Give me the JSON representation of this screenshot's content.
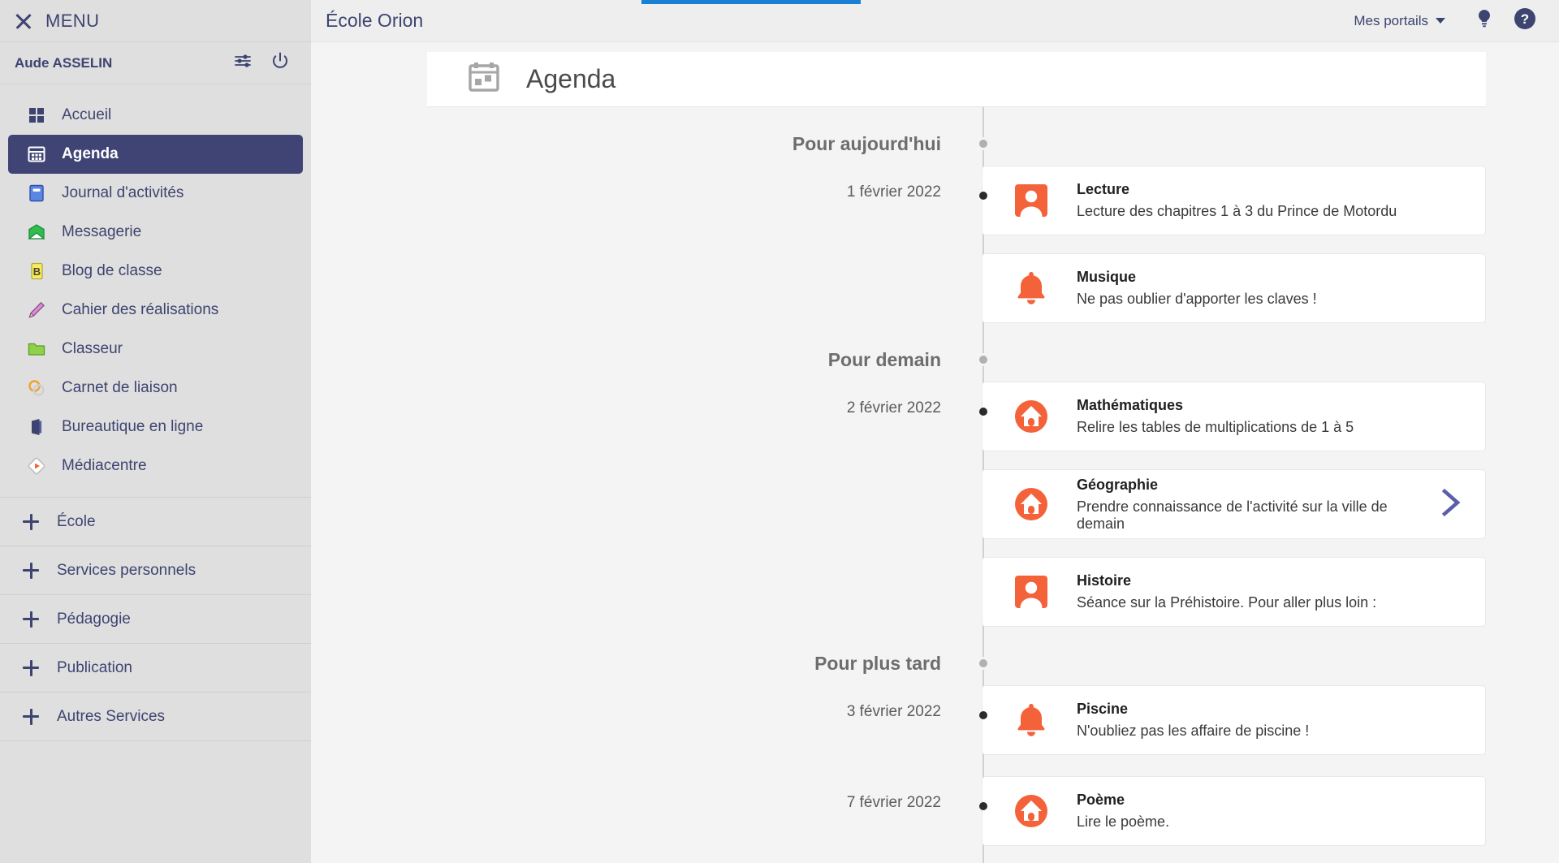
{
  "sidebar": {
    "menu_label": "MENU",
    "close_icon": "close-icon",
    "user_name": "Aude ASSELIN",
    "settings_icon": "sliders-icon",
    "power_icon": "power-icon",
    "items": [
      {
        "label": "Accueil",
        "icon": "grid-icon",
        "active": false
      },
      {
        "label": "Agenda",
        "icon": "calendar-icon",
        "active": true
      },
      {
        "label": "Journal d'activités",
        "icon": "notebook-icon",
        "active": false
      },
      {
        "label": "Messagerie",
        "icon": "envelope-icon",
        "active": false
      },
      {
        "label": "Blog de classe",
        "icon": "blog-b-icon",
        "active": false
      },
      {
        "label": "Cahier des réalisations",
        "icon": "pencil-icon",
        "active": false
      },
      {
        "label": "Classeur",
        "icon": "folder-icon",
        "active": false
      },
      {
        "label": "Carnet de liaison",
        "icon": "link-rings-icon",
        "active": false
      },
      {
        "label": "Bureautique en ligne",
        "icon": "office-icon",
        "active": false
      },
      {
        "label": "Médiacentre",
        "icon": "media-play-icon",
        "active": false
      }
    ],
    "groups": [
      {
        "label": "École"
      },
      {
        "label": "Services personnels"
      },
      {
        "label": "Pédagogie"
      },
      {
        "label": "Publication"
      },
      {
        "label": "Autres Services"
      }
    ]
  },
  "header": {
    "portal_name": "École Orion",
    "portals_label": "Mes portails",
    "caret_icon": "chevron-down-icon",
    "bulb_icon": "lightbulb-icon",
    "help_icon": "help-circle-icon",
    "loading_bar_color": "#1b7fd4"
  },
  "page": {
    "title": "Agenda",
    "icon": "calendar-page-icon"
  },
  "agenda": {
    "sections": [
      {
        "label": "Pour aujourd'hui",
        "groups": [
          {
            "date": "1 février 2022",
            "events": [
              {
                "title": "Lecture",
                "desc": "Lecture des chapitres 1 à 3 du Prince de Motordu",
                "icon": "person-square-icon",
                "chevron": false
              },
              {
                "title": "Musique",
                "desc": "Ne pas oublier d'apporter les claves !",
                "icon": "bell-icon",
                "chevron": false
              }
            ]
          }
        ]
      },
      {
        "label": "Pour demain",
        "groups": [
          {
            "date": "2 février 2022",
            "events": [
              {
                "title": "Mathématiques",
                "desc": "Relire les tables de multiplications de 1 à 5",
                "icon": "house-circle-icon",
                "chevron": false
              },
              {
                "title": "Géographie",
                "desc": "Prendre connaissance de l'activité sur la ville de demain",
                "icon": "house-circle-icon",
                "chevron": true
              },
              {
                "title": "Histoire",
                "desc": "Séance sur la Préhistoire.  Pour aller plus loin :",
                "icon": "person-square-icon",
                "chevron": false
              }
            ]
          }
        ]
      },
      {
        "label": "Pour plus tard",
        "groups": [
          {
            "date": "3 février 2022",
            "events": [
              {
                "title": "Piscine",
                "desc": "N'oubliez pas les affaire de piscine !",
                "icon": "bell-icon",
                "chevron": false
              }
            ]
          },
          {
            "date": "7 février 2022",
            "events": [
              {
                "title": "Poème",
                "desc": "Lire le poème.",
                "icon": "house-circle-icon",
                "chevron": false
              }
            ]
          }
        ]
      }
    ]
  },
  "colors": {
    "accent_orange": "#f4623a",
    "navy": "#3f4474",
    "sidebar_bg": "#dfdfdf",
    "chevron_purple": "#5c5fa8"
  }
}
